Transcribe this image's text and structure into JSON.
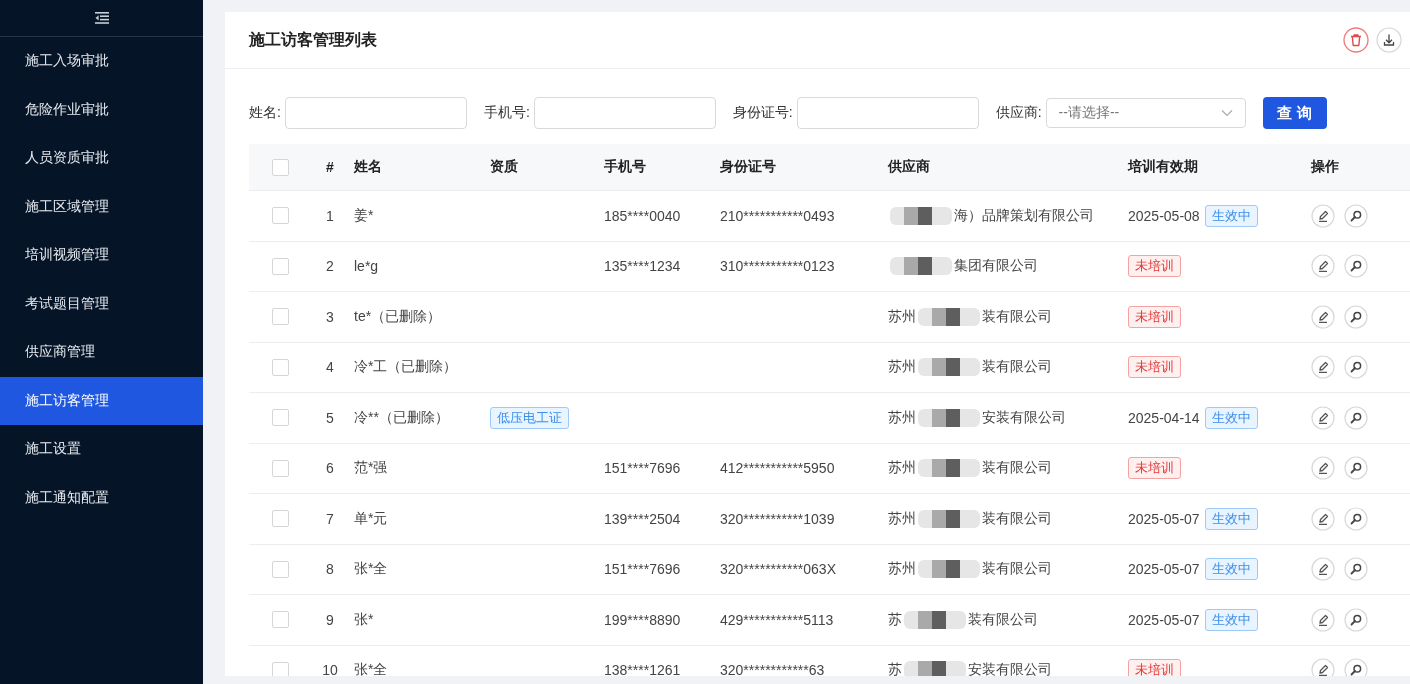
{
  "sidebar": {
    "items": [
      {
        "label": "施工入场审批",
        "selected": false
      },
      {
        "label": "危险作业审批",
        "selected": false
      },
      {
        "label": "人员资质审批",
        "selected": false
      },
      {
        "label": "施工区域管理",
        "selected": false
      },
      {
        "label": "培训视频管理",
        "selected": false
      },
      {
        "label": "考试题目管理",
        "selected": false
      },
      {
        "label": "供应商管理",
        "selected": false
      },
      {
        "label": "施工访客管理",
        "selected": true
      },
      {
        "label": "施工设置",
        "selected": false
      },
      {
        "label": "施工通知配置",
        "selected": false
      }
    ]
  },
  "card": {
    "title": "施工访客管理列表"
  },
  "filters": [
    {
      "kind": "input",
      "label": "姓名:"
    },
    {
      "kind": "input",
      "label": "手机号:"
    },
    {
      "kind": "input",
      "label": "身份证号:"
    },
    {
      "kind": "select",
      "label": "供应商:",
      "placeholder": "--请选择--"
    }
  ],
  "search_button": "查 询",
  "table": {
    "select_all_checked": false,
    "columns": [
      "#",
      "姓名",
      "资质",
      "手机号",
      "身份证号",
      "供应商",
      "培训有效期",
      "操作"
    ],
    "rows": [
      {
        "checked": false,
        "index": "1",
        "name": "姜*",
        "phone": "185****0040",
        "id_number": "210***********0493",
        "supplier_prefix": "",
        "supplier_suffix": "海）品牌策划有限公司",
        "training": {
          "kind": "active",
          "date": "2025-05-08",
          "badge": "生效中"
        }
      },
      {
        "checked": false,
        "index": "2",
        "name": "le*g",
        "phone": "135****1234",
        "id_number": "310***********0123",
        "supplier_prefix": "",
        "supplier_suffix": "集团有限公司",
        "training": {
          "kind": "untrained",
          "badge": "未培训"
        }
      },
      {
        "checked": false,
        "index": "3",
        "name": "te*（已删除）",
        "supplier_prefix": "苏州",
        "supplier_suffix": "装有限公司",
        "training": {
          "kind": "untrained",
          "badge": "未培训"
        }
      },
      {
        "checked": false,
        "index": "4",
        "name": "冷*工（已删除）",
        "supplier_prefix": "苏州",
        "supplier_suffix": "装有限公司",
        "training": {
          "kind": "untrained",
          "badge": "未培训"
        }
      },
      {
        "checked": false,
        "index": "5",
        "name": "冷**（已删除）",
        "qualification": "低压电工证",
        "supplier_prefix": "苏州",
        "supplier_suffix": "安装有限公司",
        "training": {
          "kind": "active",
          "date": "2025-04-14",
          "badge": "生效中"
        }
      },
      {
        "checked": false,
        "index": "6",
        "name": "范*强",
        "phone": "151****7696",
        "id_number": "412***********5950",
        "supplier_prefix": "苏州",
        "supplier_suffix": "装有限公司",
        "training": {
          "kind": "untrained",
          "badge": "未培训"
        }
      },
      {
        "checked": false,
        "index": "7",
        "name": "单*元",
        "phone": "139****2504",
        "id_number": "320***********1039",
        "supplier_prefix": "苏州",
        "supplier_suffix": "装有限公司",
        "training": {
          "kind": "active",
          "date": "2025-05-07",
          "badge": "生效中"
        }
      },
      {
        "checked": false,
        "index": "8",
        "name": "张*全",
        "phone": "151****7696",
        "id_number": "320***********063X",
        "supplier_prefix": "苏州",
        "supplier_suffix": "装有限公司",
        "training": {
          "kind": "active",
          "date": "2025-05-07",
          "badge": "生效中"
        }
      },
      {
        "checked": false,
        "index": "9",
        "name": "张*",
        "phone": "199****8890",
        "id_number": "429***********5113",
        "supplier_prefix": "苏",
        "supplier_suffix": "装有限公司",
        "training": {
          "kind": "active",
          "date": "2025-05-07",
          "badge": "生效中"
        }
      },
      {
        "checked": false,
        "index": "10",
        "name": "张*全",
        "phone": "138****1261",
        "id_number": "320************63",
        "supplier_prefix": "苏",
        "supplier_suffix": "安装有限公司",
        "training": {
          "kind": "untrained",
          "badge": "未培训"
        }
      }
    ]
  }
}
